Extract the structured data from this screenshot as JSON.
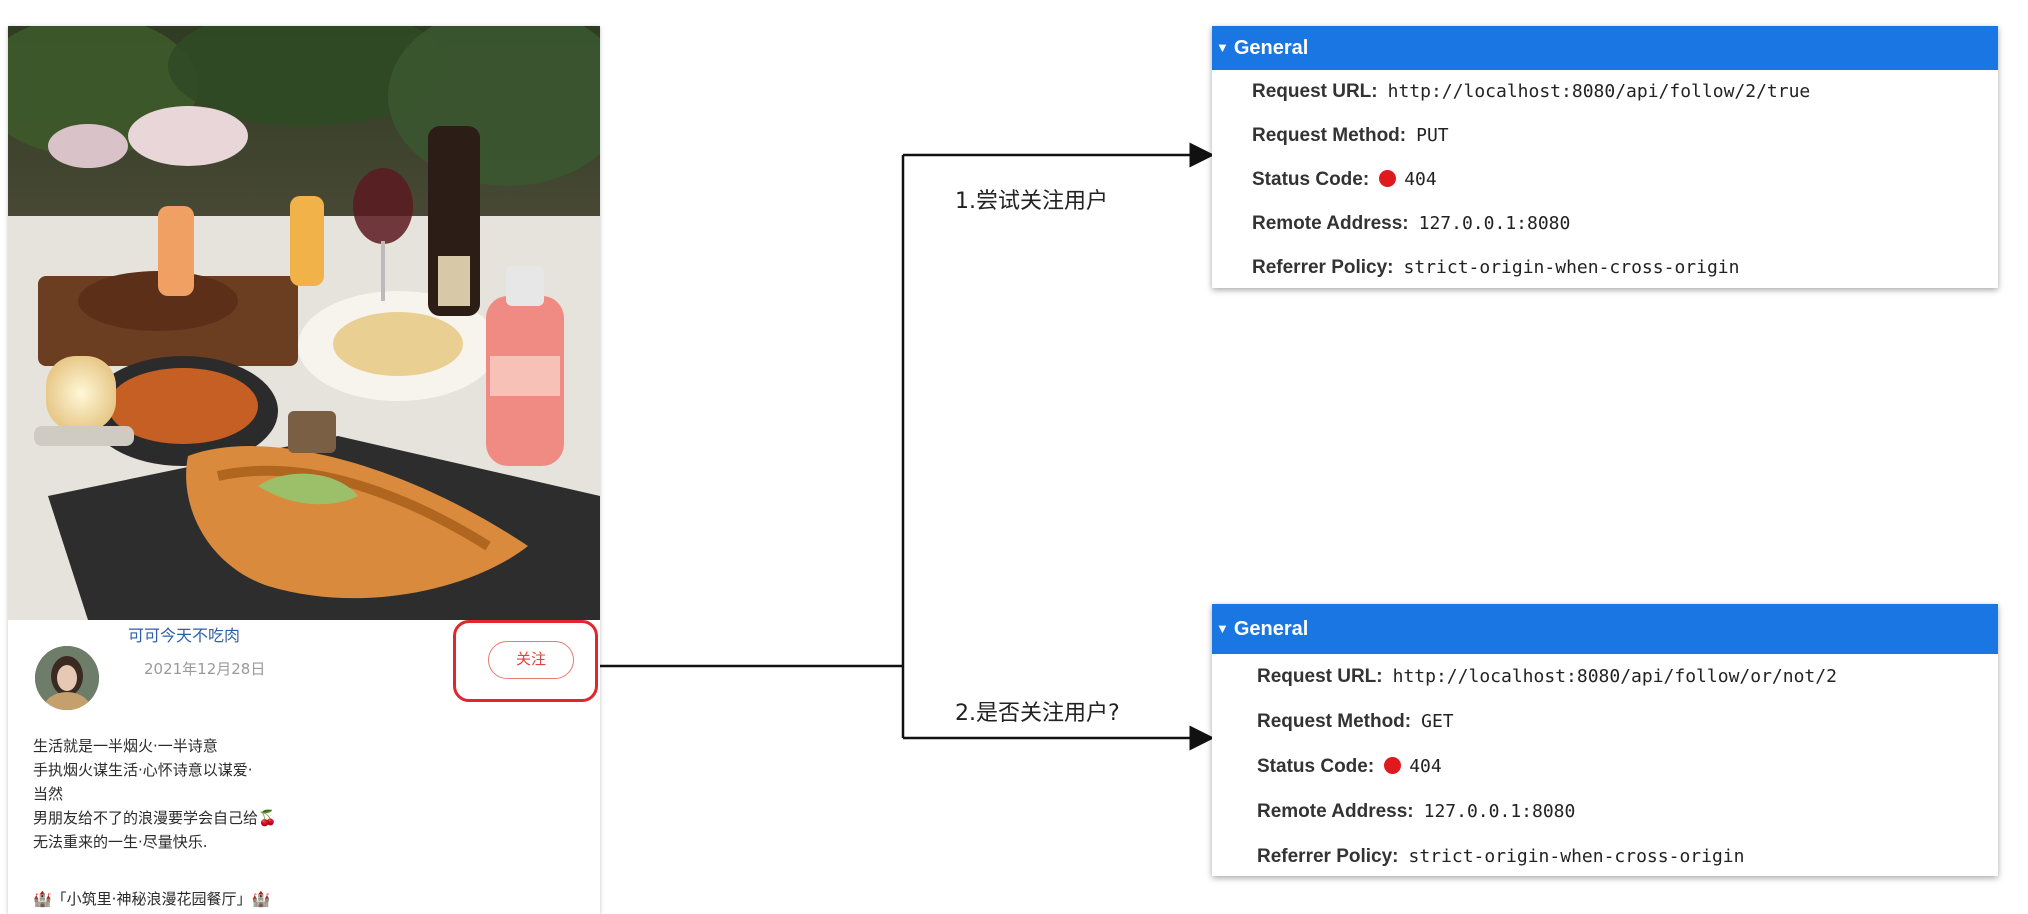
{
  "post": {
    "author": "可可今天不吃肉",
    "date": "2021年12月28日",
    "follow_label": "关注",
    "lines": [
      "生活就是一半烟火·一半诗意",
      "手执烟火谋生活·心怀诗意以谋爱·",
      "当然",
      "男朋友给不了的浪漫要学会自己给🍒",
      "无法重来的一生·尽量快乐."
    ],
    "extra_line": "🏰「小筑里·神秘浪漫花园餐厅」🏰"
  },
  "steps": {
    "step1": "1.尝试关注用户",
    "step2": "2.是否关注用户?"
  },
  "panels": [
    {
      "header": "General",
      "request_url_label": "Request URL:",
      "request_url": "http://localhost:8080/api/follow/2/true",
      "method_label": "Request Method:",
      "method": "PUT",
      "status_label": "Status Code:",
      "status": "404",
      "remote_label": "Remote Address:",
      "remote": "127.0.0.1:8080",
      "referrer_label": "Referrer Policy:",
      "referrer": "strict-origin-when-cross-origin"
    },
    {
      "header": "General",
      "request_url_label": "Request URL:",
      "request_url": "http://localhost:8080/api/follow/or/not/2",
      "method_label": "Request Method:",
      "method": "GET",
      "status_label": "Status Code:",
      "status": "404",
      "remote_label": "Remote Address:",
      "remote": "127.0.0.1:8080",
      "referrer_label": "Referrer Policy:",
      "referrer": "strict-origin-when-cross-origin"
    }
  ],
  "colors": {
    "header_blue": "#1976e3",
    "highlight_red": "#e3262d",
    "status_red": "#e0191d",
    "author_blue": "#2e5fa6"
  }
}
